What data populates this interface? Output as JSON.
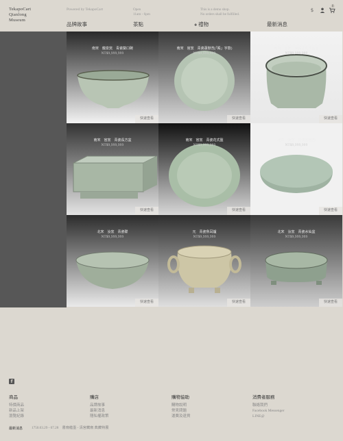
{
  "header": {
    "logo_line1": "TekapoCart",
    "logo_line2": "Qianlong",
    "logo_line3": "Museum",
    "powered_by": "Powered by TekapoCart",
    "hours_line1": "Open",
    "hours_line2": "11am - 6pm",
    "demo_line1": "This is a demo shop.",
    "demo_line2": "No orders shall be fulfilled.",
    "nav": [
      "品牌故事",
      "茶點",
      "禮物",
      "最新消息"
    ],
    "nav_gift_prefix": "✚",
    "icons": {
      "currency": "dollar-icon",
      "account": "user-icon",
      "cart": "cart-icon"
    },
    "cart_count": "0"
  },
  "products": [
    {
      "name": "南宋　龍泉窯　青瓷葵口碗",
      "price": "NT$9,999,999",
      "button": "快速查看"
    },
    {
      "name": "南宋　官窯　青瓷蓮辦洗(「殿」字款)",
      "price": "NT$9,999,999",
      "button": "快速查看"
    },
    {
      "name": "南宋　官窯　青瓷葵花式盆盤",
      "price": "NT$9,999,999",
      "button": "快速查看"
    },
    {
      "name": "南宋　官窯　青瓷長方盆",
      "price": "NT$9,999,999",
      "button": "快速查看"
    },
    {
      "name": "南宋　官窯　青瓷花式盤",
      "price": "NT$9,999,999",
      "button": "快速查看"
    },
    {
      "name": "北宋　汝窯　青瓷橢圓洗",
      "price": "NT$9,999,999",
      "button": "快速查看"
    },
    {
      "name": "北宋　汝窯　青瓷碟",
      "price": "NT$9,999,999",
      "button": "快速查看"
    },
    {
      "name": "元　青瓷魚耳爐",
      "price": "NT$9,999,999",
      "button": "快速查看"
    },
    {
      "name": "北宋　汝窯　青瓷水仙盆",
      "price": "NT$9,999,999",
      "button": "快速查看"
    }
  ],
  "footer": {
    "columns": [
      {
        "title": "商品",
        "links": [
          "特價商品",
          "新品上架",
          "瀏覽紀錄"
        ]
      },
      {
        "title": "購店",
        "links": [
          "品牌故事",
          "最新消息",
          "隱私權政策"
        ]
      },
      {
        "title": "購物協助",
        "links": [
          "購物說明",
          "常見問題",
          "運費及退貨"
        ]
      },
      {
        "title": "消費者服務",
        "links": [
          "聯絡我們",
          "Facebook Messenger",
          "LINE@"
        ]
      }
    ],
    "news_label": "最新消息",
    "news_text": "1750.03.29 - 07.28　書扇蘊墨 - 清宮藏扇 典藏特展"
  }
}
